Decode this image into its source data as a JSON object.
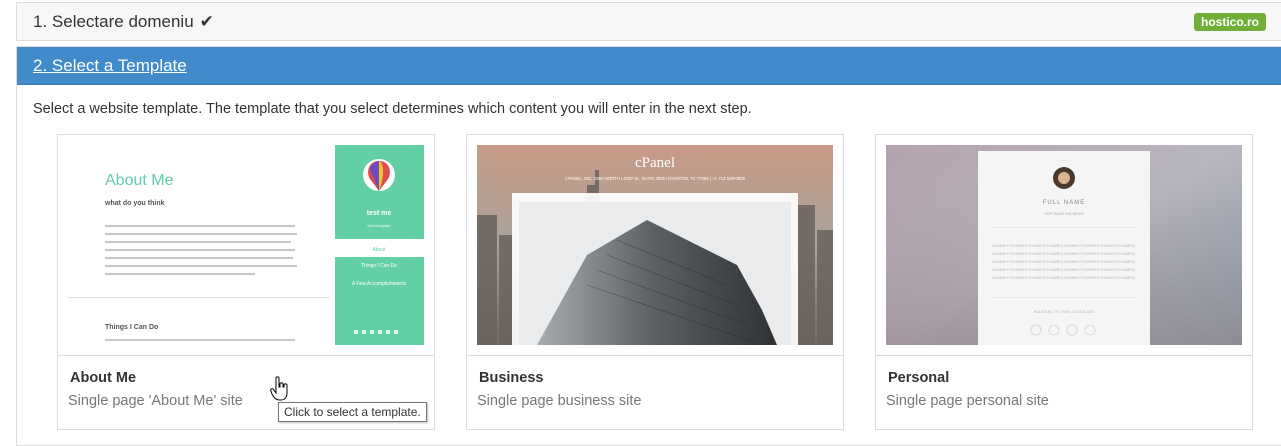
{
  "step1": {
    "label": "1. Selectare domeniu",
    "check_icon": "check-icon"
  },
  "brand": {
    "label": "hostico.ro",
    "color": "#6faf3a"
  },
  "step2": {
    "title": "2. Select a Template",
    "header_color": "#428bca"
  },
  "intro": "Select a website template. The template that you select determines which content you will enter in the next step.",
  "templates": [
    {
      "name": "About Me",
      "description": "Single page 'About Me' site",
      "preview": {
        "heading": "About Me",
        "subheading": "what do you think",
        "section_heading": "Things I Can Do",
        "side_name": "test me",
        "side_subtitle": "test template",
        "side_link": "About",
        "side_items": [
          "Things I Can Do",
          "A Few Accomplishments"
        ],
        "accent": "#63cfa5"
      }
    },
    {
      "name": "Business",
      "description": "Single page business site",
      "preview": {
        "brand": "cPanel",
        "address": "CPANEL, INC. 2550 NORTH LOOP W., SUITE 4006 HOUSTON, TX 77092 | +1 713-529-0800"
      }
    },
    {
      "name": "Personal",
      "description": "Single page personal site",
      "preview": {
        "name": "FULL NAME",
        "role": "SOFTWARE ENGINEER",
        "sample": "EXAMPLE EXAMPLE EXAMPLE EXAMPLE EXAMPLE EXAMPLE EXAMPLE EXAMPLE",
        "location": "HOUSTON, TX 77098 | 713-529-2670"
      }
    }
  ],
  "tooltip": "Click to select a template."
}
